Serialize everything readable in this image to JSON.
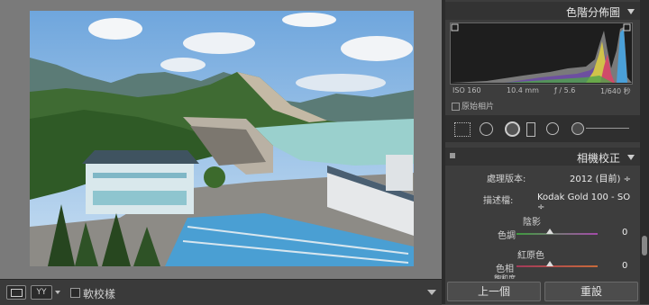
{
  "histogram": {
    "title": "色階分佈圖",
    "iso": "ISO 160",
    "focal": "10.4 mm",
    "aperture": "ƒ / 5.6",
    "shutter": "1/640 秒",
    "original_photo_label": "原始相片"
  },
  "camera_calibration": {
    "title": "相機校正",
    "process_label": "處理版本:",
    "process_value": "2012 (目前) ÷",
    "profile_label": "描述檔:",
    "profile_value": "Kodak Gold 100 - SO ÷",
    "shadows_label": "陰影",
    "tint_label": "色調",
    "tint_value": "0",
    "red_primary_label": "紅原色",
    "hue_label": "色相",
    "hue_value": "0",
    "saturation_label": "飽和度"
  },
  "toolbar": {
    "soft_proof_label": "軟校樣",
    "compare_label": "YY"
  },
  "footer": {
    "previous_label": "上一個",
    "reset_label": "重設"
  },
  "colors": {
    "panel_bg": "#3d3d3d",
    "header_bg": "#333333",
    "canvas_bg": "#7a7a7a"
  }
}
